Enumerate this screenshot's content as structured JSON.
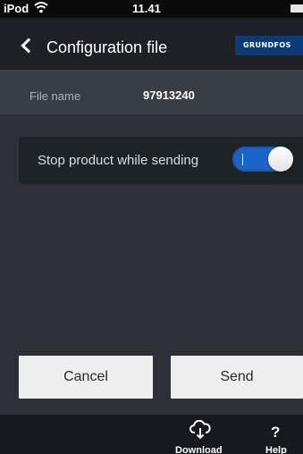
{
  "status_bar": {
    "carrier": "iPod",
    "time": "11.41"
  },
  "header": {
    "title": "Configuration file",
    "logo_text": "GRUNDFOS"
  },
  "file": {
    "label": "File name",
    "value": "97913240"
  },
  "setting": {
    "label": "Stop product while sending",
    "toggle_on": true
  },
  "buttons": {
    "cancel_label": "Cancel",
    "send_label": "Send"
  },
  "toolbar": {
    "download_label": "Download",
    "help_label": "Help",
    "help_glyph": "?"
  },
  "colors": {
    "background": "#2d3137",
    "header": "#1d2126",
    "accent_toggle": "#1a63c9",
    "logo_bg": "#0b3a78"
  },
  "icons": {
    "wifi": "wifi-icon",
    "battery": "battery-icon",
    "back": "chevron-left-icon",
    "download": "cloud-download-icon",
    "help": "question-mark-icon"
  }
}
